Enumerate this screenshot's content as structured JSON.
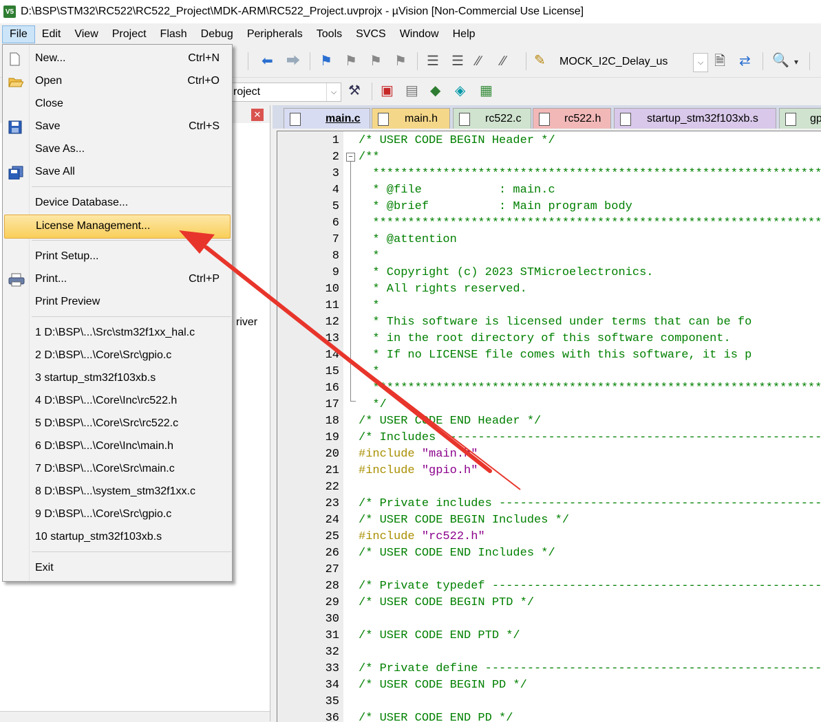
{
  "window": {
    "title": "D:\\BSP\\STM32\\RC522\\RC522_Project\\MDK-ARM\\RC522_Project.uvprojx - µVision  [Non-Commercial Use License]",
    "app_icon_label": "V5"
  },
  "menubar": [
    "File",
    "Edit",
    "View",
    "Project",
    "Flash",
    "Debug",
    "Peripherals",
    "Tools",
    "SVCS",
    "Window",
    "Help"
  ],
  "toolbar": {
    "target_combo": "MOCK_I2C_Delay_us",
    "project_combo_fragment": "roject"
  },
  "left_panel": {
    "fragment_text": "river"
  },
  "file_menu": {
    "items": [
      {
        "label": "New...",
        "shortcut": "Ctrl+N",
        "icon": "new-file-icon"
      },
      {
        "label": "Open",
        "shortcut": "Ctrl+O",
        "icon": "open-folder-icon"
      },
      {
        "label": "Close",
        "shortcut": "",
        "icon": ""
      },
      {
        "label": "Save",
        "shortcut": "Ctrl+S",
        "icon": "save-icon"
      },
      {
        "label": "Save As...",
        "shortcut": "",
        "icon": ""
      },
      {
        "label": "Save All",
        "shortcut": "",
        "icon": "save-all-icon"
      },
      {
        "label": "Device Database...",
        "shortcut": "",
        "icon": ""
      },
      {
        "label": "License Management...",
        "shortcut": "",
        "icon": ""
      },
      {
        "label": "Print Setup...",
        "shortcut": "",
        "icon": ""
      },
      {
        "label": "Print...",
        "shortcut": "Ctrl+P",
        "icon": "printer-icon"
      },
      {
        "label": "Print Preview",
        "shortcut": "",
        "icon": ""
      },
      {
        "label": "1 D:\\BSP\\...\\Src\\stm32f1xx_hal.c",
        "shortcut": "",
        "icon": ""
      },
      {
        "label": "2 D:\\BSP\\...\\Core\\Src\\gpio.c",
        "shortcut": "",
        "icon": ""
      },
      {
        "label": "3 startup_stm32f103xb.s",
        "shortcut": "",
        "icon": ""
      },
      {
        "label": "4 D:\\BSP\\...\\Core\\Inc\\rc522.h",
        "shortcut": "",
        "icon": ""
      },
      {
        "label": "5 D:\\BSP\\...\\Core\\Src\\rc522.c",
        "shortcut": "",
        "icon": ""
      },
      {
        "label": "6 D:\\BSP\\...\\Core\\Inc\\main.h",
        "shortcut": "",
        "icon": ""
      },
      {
        "label": "7 D:\\BSP\\...\\Core\\Src\\main.c",
        "shortcut": "",
        "icon": ""
      },
      {
        "label": "8 D:\\BSP\\...\\system_stm32f1xx.c",
        "shortcut": "",
        "icon": ""
      },
      {
        "label": "9 D:\\BSP\\...\\Core\\Src\\gpio.c",
        "shortcut": "",
        "icon": ""
      },
      {
        "label": "10 startup_stm32f103xb.s",
        "shortcut": "",
        "icon": ""
      },
      {
        "label": "Exit",
        "shortcut": "",
        "icon": ""
      }
    ],
    "highlighted_item": "License Management..."
  },
  "tabs": [
    {
      "label": "main.c",
      "color": "#d7dcf2",
      "active": true
    },
    {
      "label": "main.h",
      "color": "#f5d789",
      "active": false
    },
    {
      "label": "rc522.c",
      "color": "#cfe3cf",
      "active": false
    },
    {
      "label": "rc522.h",
      "color": "#f2b8b8",
      "active": false
    },
    {
      "label": "startup_stm32f103xb.s",
      "color": "#d9c8ea",
      "active": false
    },
    {
      "label": "gp",
      "color": "#cfe3cf",
      "active": false
    }
  ],
  "editor": {
    "lines": [
      {
        "n": "1",
        "segs": [
          {
            "t": "/* USER CODE BEGIN Header */",
            "c": "cmt"
          }
        ]
      },
      {
        "n": "2",
        "segs": [
          {
            "t": "/**",
            "c": "cmt"
          }
        ]
      },
      {
        "n": "3",
        "segs": [
          {
            "t": "  ******************************************************************************",
            "c": "cmt"
          }
        ]
      },
      {
        "n": "4",
        "segs": [
          {
            "t": "  * @file           : main.c",
            "c": "cmt"
          }
        ]
      },
      {
        "n": "5",
        "segs": [
          {
            "t": "  * @brief          : Main program body",
            "c": "cmt"
          }
        ]
      },
      {
        "n": "6",
        "segs": [
          {
            "t": "  ******************************************************************************",
            "c": "cmt"
          }
        ]
      },
      {
        "n": "7",
        "segs": [
          {
            "t": "  * @attention",
            "c": "cmt"
          }
        ]
      },
      {
        "n": "8",
        "segs": [
          {
            "t": "  *",
            "c": "cmt"
          }
        ]
      },
      {
        "n": "9",
        "segs": [
          {
            "t": "  * Copyright (c) 2023 STMicroelectronics.",
            "c": "cmt"
          }
        ]
      },
      {
        "n": "10",
        "segs": [
          {
            "t": "  * All rights reserved.",
            "c": "cmt"
          }
        ]
      },
      {
        "n": "11",
        "segs": [
          {
            "t": "  *",
            "c": "cmt"
          }
        ]
      },
      {
        "n": "12",
        "segs": [
          {
            "t": "  * This software is licensed under terms that can be fo",
            "c": "cmt"
          }
        ]
      },
      {
        "n": "13",
        "segs": [
          {
            "t": "  * in the root directory of this software component.",
            "c": "cmt"
          }
        ]
      },
      {
        "n": "14",
        "segs": [
          {
            "t": "  * If no LICENSE file comes with this software, it is p",
            "c": "cmt"
          }
        ]
      },
      {
        "n": "15",
        "segs": [
          {
            "t": "  *",
            "c": "cmt"
          }
        ]
      },
      {
        "n": "16",
        "segs": [
          {
            "t": "  ******************************************************************************",
            "c": "cmt"
          }
        ]
      },
      {
        "n": "17",
        "segs": [
          {
            "t": "  */",
            "c": "cmt"
          }
        ]
      },
      {
        "n": "18",
        "segs": [
          {
            "t": "/* USER CODE END Header */",
            "c": "cmt"
          }
        ]
      },
      {
        "n": "19",
        "segs": [
          {
            "t": "/* Includes ------------------------------------------------------------------",
            "c": "cmt"
          }
        ]
      },
      {
        "n": "20",
        "segs": [
          {
            "t": "#include ",
            "c": "pp"
          },
          {
            "t": "\"main.h\"",
            "c": "str"
          }
        ]
      },
      {
        "n": "21",
        "segs": [
          {
            "t": "#include ",
            "c": "pp"
          },
          {
            "t": "\"gpio.h\"",
            "c": "str"
          }
        ]
      },
      {
        "n": "22",
        "segs": []
      },
      {
        "n": "23",
        "segs": [
          {
            "t": "/* Private includes ----------------------------------------------------------",
            "c": "cmt"
          }
        ]
      },
      {
        "n": "24",
        "segs": [
          {
            "t": "/* USER CODE BEGIN Includes */",
            "c": "cmt"
          }
        ]
      },
      {
        "n": "25",
        "segs": [
          {
            "t": "#include ",
            "c": "pp"
          },
          {
            "t": "\"rc522.h\"",
            "c": "str"
          }
        ]
      },
      {
        "n": "26",
        "segs": [
          {
            "t": "/* USER CODE END Includes */",
            "c": "cmt"
          }
        ]
      },
      {
        "n": "27",
        "segs": []
      },
      {
        "n": "28",
        "segs": [
          {
            "t": "/* Private typedef -----------------------------------------------------------",
            "c": "cmt"
          }
        ]
      },
      {
        "n": "29",
        "segs": [
          {
            "t": "/* USER CODE BEGIN PTD */",
            "c": "cmt"
          }
        ]
      },
      {
        "n": "30",
        "segs": []
      },
      {
        "n": "31",
        "segs": [
          {
            "t": "/* USER CODE END PTD */",
            "c": "cmt"
          }
        ]
      },
      {
        "n": "32",
        "segs": []
      },
      {
        "n": "33",
        "segs": [
          {
            "t": "/* Private define ------------------------------------------------------------",
            "c": "cmt"
          }
        ]
      },
      {
        "n": "34",
        "segs": [
          {
            "t": "/* USER CODE BEGIN PD */",
            "c": "cmt"
          }
        ]
      },
      {
        "n": "35",
        "segs": []
      },
      {
        "n": "36",
        "segs": [
          {
            "t": "/* USER CODE END PD */",
            "c": "cmt"
          }
        ]
      }
    ]
  },
  "colors": {
    "comment": "#008000",
    "preprocessor": "#a98f00",
    "string": "#8b008b",
    "menu_highlight": "#f9cf5a",
    "annotation_arrow": "#e8352b"
  }
}
